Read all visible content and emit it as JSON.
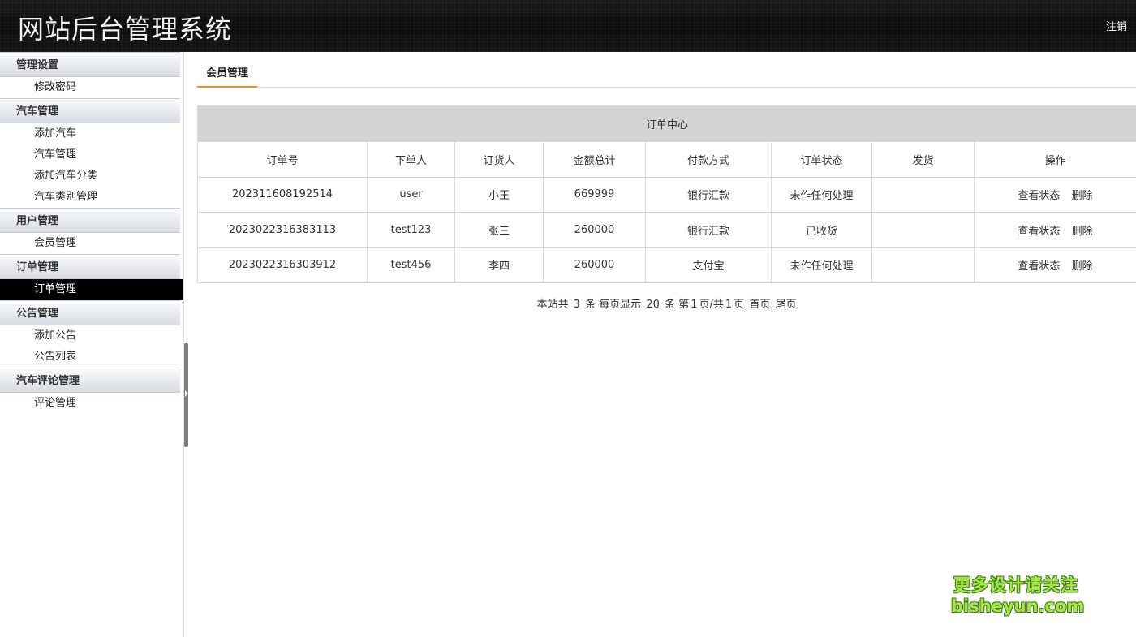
{
  "header": {
    "title": "网站后台管理系统",
    "logout": "注销"
  },
  "sidebar": {
    "groups": [
      {
        "title": "管理设置",
        "items": [
          "修改密码"
        ]
      },
      {
        "title": "汽车管理",
        "items": [
          "添加汽车",
          "汽车管理",
          "添加汽车分类",
          "汽车类别管理"
        ]
      },
      {
        "title": "用户管理",
        "items": [
          "会员管理"
        ]
      },
      {
        "title": "订单管理",
        "items": [
          "订单管理"
        ]
      },
      {
        "title": "公告管理",
        "items": [
          "添加公告",
          "公告列表"
        ]
      },
      {
        "title": "汽车评论管理",
        "items": [
          "评论管理"
        ]
      }
    ],
    "active_item": "订单管理"
  },
  "tab": {
    "label": "会员管理"
  },
  "table": {
    "caption": "订单中心",
    "headers": [
      "订单号",
      "下单人",
      "订货人",
      "金额总计",
      "付款方式",
      "订单状态",
      "发货",
      "操作"
    ],
    "rows": [
      {
        "order_no": "202311608192514",
        "buyer": "user",
        "receiver": "小王",
        "total": "669999",
        "payment": "银行汇款",
        "status": "未作任何处理",
        "ship": ""
      },
      {
        "order_no": "2023022316383113",
        "buyer": "test123",
        "receiver": "张三",
        "total": "260000",
        "payment": "银行汇款",
        "status": "已收货",
        "ship": ""
      },
      {
        "order_no": "2023022316303912",
        "buyer": "test456",
        "receiver": "李四",
        "total": "260000",
        "payment": "支付宝",
        "status": "未作任何处理",
        "ship": ""
      }
    ],
    "actions": {
      "view": "查看状态",
      "delete": "删除"
    }
  },
  "pager": {
    "prefix": "本站共",
    "total": "3",
    "per_page_label": "条 每页显示",
    "per_page": "20",
    "page_label": "条 第",
    "current": "1",
    "of_label": "页/共",
    "pages": "1",
    "page_suffix": "页",
    "first": "首页",
    "last": "尾页"
  },
  "watermark": {
    "line1": "更多设计请关注",
    "line2": "bisheyun.com"
  }
}
